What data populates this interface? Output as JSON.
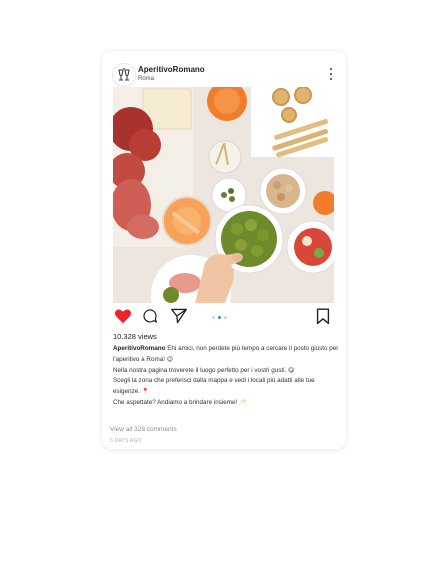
{
  "post": {
    "username": "AperitivoRomano",
    "location": "Roma",
    "views": "10.328 views",
    "caption_user": "AperitivoRomano",
    "caption_line1": "Ehi amici, non perdete più tempo a cercare il posto giusto per l'aperitivo a Roma!",
    "caption_line2": "Nella nostra pagina troverete il luogo perfetto per i vostri gusti.",
    "caption_line3": "Scegli la zona che preferisci dalla mappa e vedi i locali più adatti alle tue esigenze.",
    "caption_line4": "Che aspettate? Andiamo a brindare insieme!",
    "emoji1": "😉",
    "emoji2": "😋",
    "emoji3": "📍",
    "emoji4": "🥂",
    "comments_link": "View all 328 comments",
    "timestamp": "5 DAYS AGO"
  },
  "carousel": {
    "count": 3,
    "active_index": 1
  },
  "icons": {
    "avatar": "cheers-glasses-logo-icon",
    "more": "more-vertical-icon",
    "like": "heart-filled-icon",
    "comment": "comment-bubble-icon",
    "share": "send-icon",
    "save": "bookmark-icon"
  },
  "colors": {
    "like": "#e8262b",
    "accent_dot": "#3a8fd6",
    "text": "#222222",
    "muted": "#8e8e8e"
  }
}
